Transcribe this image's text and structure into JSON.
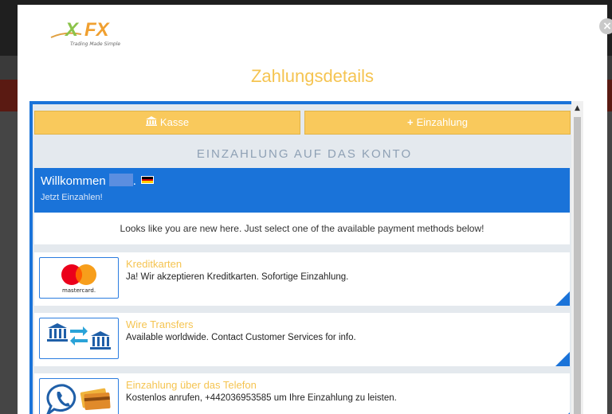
{
  "modal": {
    "title": "Zahlungsdetails",
    "close_glyph": "×",
    "logo": {
      "brand": "XFX",
      "tagline": "Trading Made Simple"
    }
  },
  "tabs": {
    "kasse": {
      "label": "Kasse",
      "icon": "bank-icon"
    },
    "einzahlung": {
      "label": "Einzahlung",
      "icon": "plus-icon"
    }
  },
  "section_heading": "EINZAHLUNG AUF DAS KONTO",
  "welcome": {
    "title": "Willkommen",
    "suffix": ".",
    "subtitle": "Jetzt Einzahlen!",
    "flag": "german-flag"
  },
  "info_text": "Looks like you are new here. Just select one of the available payment methods below!",
  "methods": [
    {
      "title": "Kreditkarten",
      "desc": "Ja! Wir akzeptieren Kreditkarten. Sofortige Einzahlung.",
      "icon": "mastercard-icon",
      "icon_text": "mastercard."
    },
    {
      "title": "Wire Transfers",
      "desc": "Available worldwide. Contact Customer Services for info.",
      "icon": "bank-transfer-icon"
    },
    {
      "title": "Einzahlung über das Telefon",
      "desc": "Kostenlos anrufen, +442036953585 um Ihre Einzahlung zu leisten.",
      "icon": "phone-card-icon"
    }
  ],
  "colors": {
    "accent_blue": "#1a73d9",
    "accent_yellow": "#f5c451",
    "button_yellow": "#f9c95c"
  }
}
